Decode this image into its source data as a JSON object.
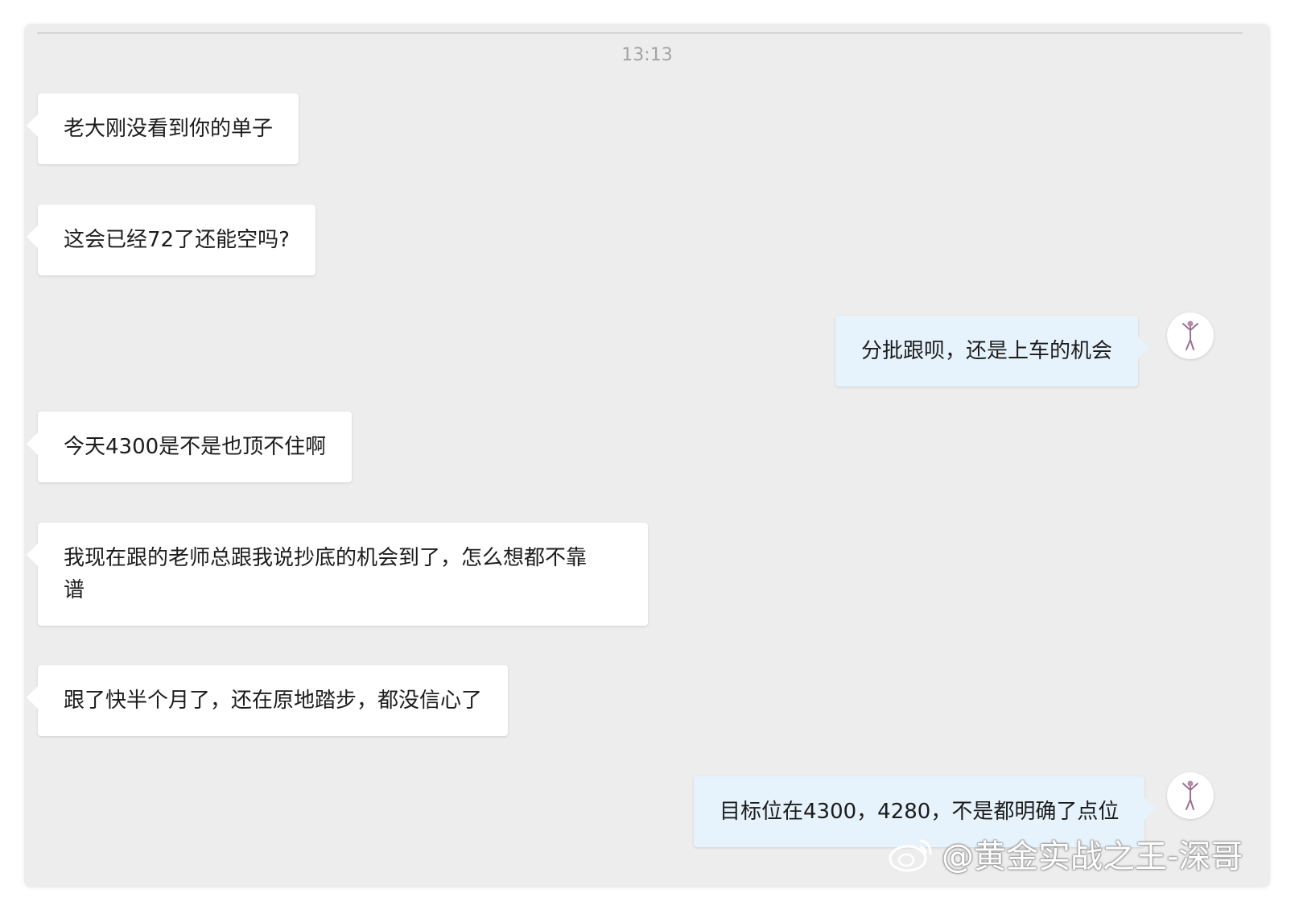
{
  "chat": {
    "timestamp": "13:13",
    "messages": [
      {
        "side": "left",
        "text": "老大刚没看到你的单子"
      },
      {
        "side": "left",
        "text": "这会已经72了还能空吗?"
      },
      {
        "side": "right",
        "text": "分批跟呗，还是上车的机会"
      },
      {
        "side": "left",
        "text": "今天4300是不是也顶不住啊"
      },
      {
        "side": "left",
        "lines": [
          "我现在跟的老师总跟我说抄底的机会到了，怎么想都不靠",
          "谱"
        ]
      },
      {
        "side": "left",
        "text": "跟了快半个月了，还在原地踏步，都没信心了"
      },
      {
        "side": "right",
        "text": "目标位在4300，4280，不是都明确了点位"
      }
    ]
  },
  "watermark": {
    "text": "@黄金实战之王-深哥",
    "icon": "weibo-icon"
  },
  "colors": {
    "background": "#ededed",
    "incoming_bubble": "#ffffff",
    "outgoing_bubble": "#e7f3fc",
    "timestamp": "#a3a3a3"
  }
}
